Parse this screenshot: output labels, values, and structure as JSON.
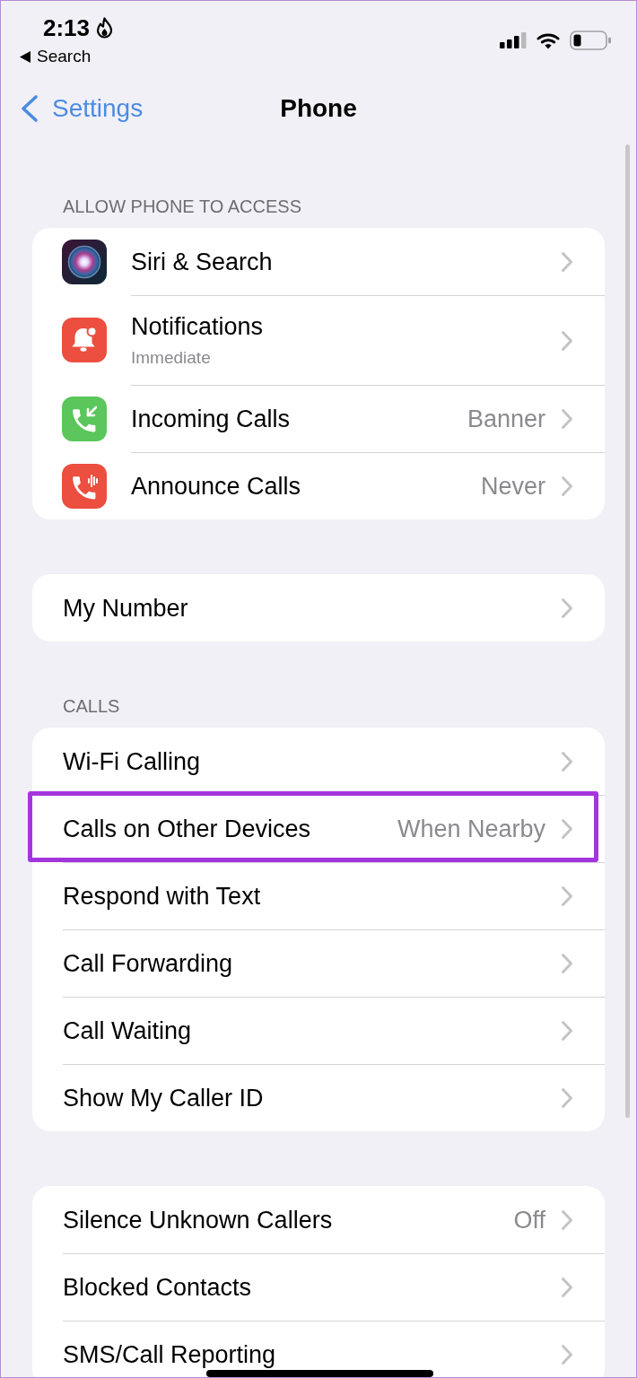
{
  "status_bar": {
    "time": "2:13",
    "back_to_app": "Search"
  },
  "nav": {
    "back": "Settings",
    "title": "Phone"
  },
  "sections": [
    {
      "header": "ALLOW PHONE TO ACCESS",
      "rows": [
        {
          "kind": "orb",
          "label": "Siri & Search",
          "highlighted": false
        },
        {
          "kind": "bell",
          "label": "Notifications",
          "subtitle": "Immediate",
          "highlighted": false
        },
        {
          "kind": "incoming-call",
          "label": "Incoming Calls",
          "value": "Banner",
          "highlighted": false
        },
        {
          "kind": "announce-call",
          "label": "Announce Calls",
          "value": "Never",
          "highlighted": false
        }
      ]
    },
    {
      "rows": [
        {
          "kind": "plain",
          "label": "My Number",
          "highlighted": false
        }
      ]
    },
    {
      "header": "CALLS",
      "rows": [
        {
          "kind": "plain",
          "label": "Wi-Fi Calling",
          "highlighted": false
        },
        {
          "kind": "plain",
          "label": "Calls on Other Devices",
          "value": "When Nearby",
          "highlighted": true
        },
        {
          "kind": "plain",
          "label": "Respond with Text",
          "highlighted": false
        },
        {
          "kind": "plain",
          "label": "Call Forwarding",
          "highlighted": false
        },
        {
          "kind": "plain",
          "label": "Call Waiting",
          "highlighted": false
        },
        {
          "kind": "plain",
          "label": "Show My Caller ID",
          "highlighted": false
        }
      ]
    },
    {
      "rows": [
        {
          "kind": "plain",
          "label": "Silence Unknown Callers",
          "value": "Off",
          "highlighted": false
        },
        {
          "kind": "plain",
          "label": "Blocked Contacts",
          "highlighted": false
        },
        {
          "kind": "plain",
          "label": "SMS/Call Reporting",
          "highlighted": false
        }
      ]
    }
  ]
}
